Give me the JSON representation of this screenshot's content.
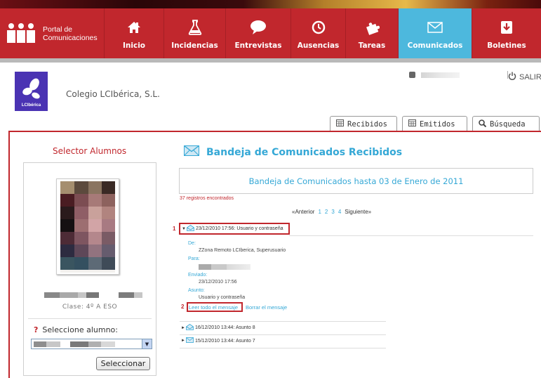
{
  "brand": {
    "portal_line1": "Portal de",
    "portal_line2": "Comunicaciones",
    "school_name": "Colegio LCIbérica, S.L.",
    "logo_text": "LCIbérica"
  },
  "nav": {
    "items": [
      {
        "label": "Inicio",
        "icon": "home-icon"
      },
      {
        "label": "Incidencias",
        "icon": "flask-icon"
      },
      {
        "label": "Entrevistas",
        "icon": "chat-bubble-icon"
      },
      {
        "label": "Ausencias",
        "icon": "clock-icon"
      },
      {
        "label": "Tareas",
        "icon": "puzzle-icon"
      },
      {
        "label": "Comunicados",
        "icon": "envelope-icon",
        "active": true
      },
      {
        "label": "Boletines",
        "icon": "download-icon"
      }
    ]
  },
  "header": {
    "exit_label": "SALIR"
  },
  "tabs": [
    {
      "label": "Recibidos",
      "icon": "calendar-icon"
    },
    {
      "label": "Emitidos",
      "icon": "calendar-icon"
    },
    {
      "label": "Búsqueda",
      "icon": "search-icon"
    }
  ],
  "selector": {
    "title": "Selector Alumnos",
    "clase": "Clase: 4º A ESO",
    "prompt_mark": "?",
    "prompt": "Seleccione alumno:",
    "button": "Seleccionar"
  },
  "inbox": {
    "title": "Bandeja de Comunicados Recibidos",
    "banner": "Bandeja de Comunicados hasta 03 de Enero de 2011",
    "count": "37 registros encontrados",
    "pager": {
      "prev": "«Anterior",
      "pages": [
        "1",
        "2",
        "3",
        "4"
      ],
      "next": "Siguiente»"
    },
    "expanded_message": {
      "marker": "1",
      "header": "23/12/2010 17:56: Usuario y contraseña",
      "de_label": "De:",
      "de_value": "ZZona Remoto LCIberica, Superusuario",
      "para_label": "Para:",
      "enviado_label": "Enviado:",
      "enviado_value": "23/12/2010 17:56",
      "asunto_label": "Asunto:",
      "asunto_value": "Usuario y contraseña",
      "action_marker": "2",
      "read_all": "Leer todo el mensaje",
      "delete": "Borrar el mensaje"
    },
    "messages": [
      {
        "header": "16/12/2010 13:44: Asunto 8"
      },
      {
        "header": "15/12/2010 13:44: Asunto 7"
      }
    ]
  },
  "colors": {
    "brand_red": "#c1272d",
    "accent_blue": "#35a8d6",
    "active_nav": "#4db8dd",
    "logo_purple": "#4a33b3"
  }
}
